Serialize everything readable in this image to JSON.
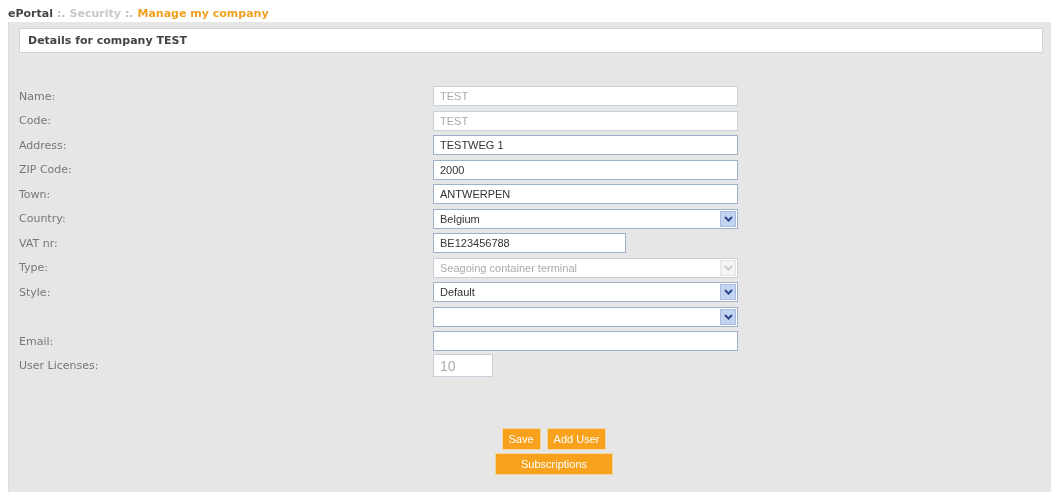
{
  "breadcrumb": [
    {
      "label": "ePortal",
      "kind": "root"
    },
    {
      "label": ":.",
      "kind": "separator"
    },
    {
      "label": "Security",
      "kind": "muted"
    },
    {
      "label": ":.",
      "kind": "separator"
    },
    {
      "label": "Manage my company",
      "kind": "current"
    }
  ],
  "panel": {
    "title": "Details for company TEST"
  },
  "fields": [
    {
      "label": "Name:",
      "kind": "text",
      "value": "TEST",
      "disabled": true
    },
    {
      "label": "Code:",
      "kind": "text",
      "value": "TEST",
      "disabled": true
    },
    {
      "label": "Address:",
      "kind": "text",
      "value": "TESTWEG 1",
      "disabled": false
    },
    {
      "label": "ZIP Code:",
      "kind": "text",
      "value": "2000",
      "disabled": false
    },
    {
      "label": "Town:",
      "kind": "text",
      "value": "ANTWERPEN",
      "disabled": false
    },
    {
      "label": "Country:",
      "kind": "select",
      "value": "Belgium",
      "disabled": false
    },
    {
      "label": "VAT nr:",
      "kind": "short",
      "value": "BE123456788",
      "disabled": false
    },
    {
      "label": "Type:",
      "kind": "select",
      "value": "Seagoing container terminal",
      "disabled": true
    },
    {
      "label": "Style:",
      "kind": "select",
      "value": "Default",
      "disabled": false
    },
    {
      "kind": "select",
      "disabled": false
    },
    {
      "label": "Email:",
      "kind": "text",
      "disabled": false
    },
    {
      "label": "User Licenses:",
      "kind": "number",
      "value": "10",
      "disabled": true
    }
  ],
  "buttons": [
    [
      "Save",
      "Add User"
    ],
    [
      "Subscriptions"
    ]
  ]
}
